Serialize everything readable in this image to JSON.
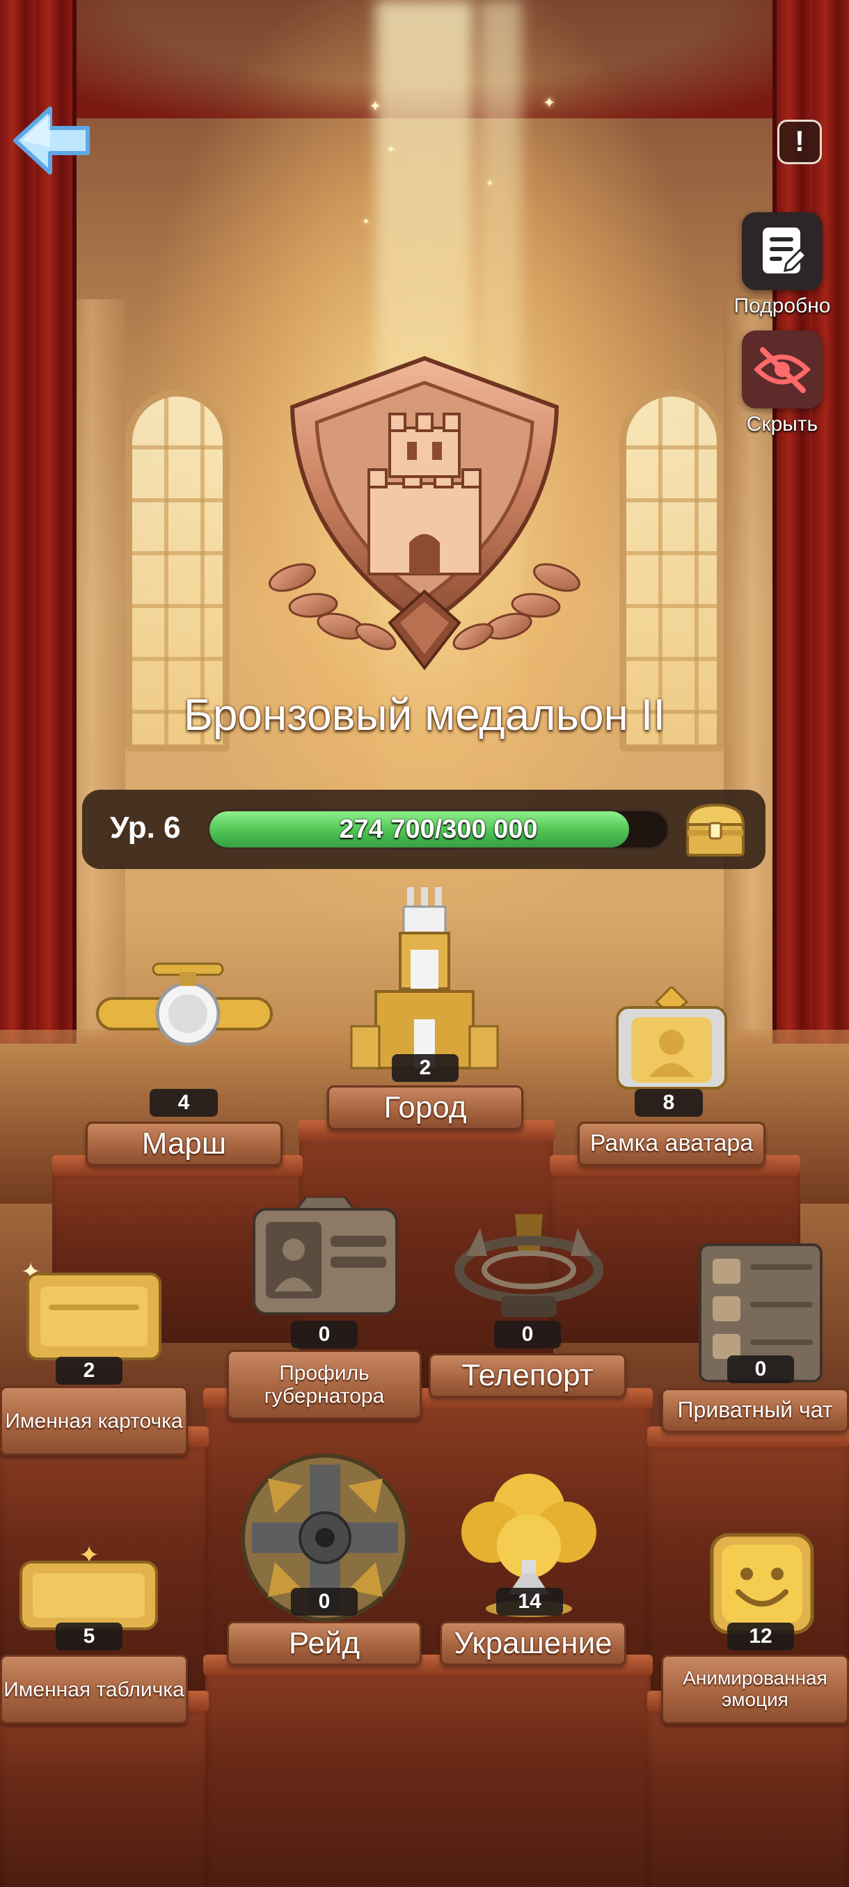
{
  "header": {
    "back_icon": "back-arrow-icon",
    "alert_icon": "exclamation-icon",
    "alert_symbol": "!",
    "details_label": "Подробно",
    "details_icon": "document-icon",
    "hide_label": "Скрыть",
    "hide_icon": "eye-off-icon"
  },
  "medal": {
    "icon": "bronze-castle-shield-medal",
    "title": "Бронзовый медальон II"
  },
  "level": {
    "label": "Ур. 6",
    "progress_text": "274 700/300 000",
    "progress_fraction": 0.9157,
    "reward_icon": "treasure-chest-icon"
  },
  "rewards": [
    {
      "id": "march",
      "label": "Марш",
      "count": "4",
      "icon": "airplane-icon"
    },
    {
      "id": "city",
      "label": "Город",
      "count": "2",
      "icon": "castle-icon"
    },
    {
      "id": "avatar-frame",
      "label": "Рамка аватара",
      "count": "8",
      "icon": "avatar-frame-icon"
    },
    {
      "id": "name-card",
      "label": "Именная карточка",
      "count": "2",
      "icon": "name-card-icon"
    },
    {
      "id": "governor-profile",
      "label": "Профиль губернатора",
      "count": "0",
      "icon": "profile-card-icon"
    },
    {
      "id": "teleport",
      "label": "Телепорт",
      "count": "0",
      "icon": "teleport-ring-icon"
    },
    {
      "id": "private-chat",
      "label": "Приватный чат",
      "count": "0",
      "icon": "chat-list-icon"
    },
    {
      "id": "nameplate",
      "label": "Именная табличка",
      "count": "5",
      "icon": "nameplate-icon"
    },
    {
      "id": "raid",
      "label": "Рейд",
      "count": "0",
      "icon": "raid-shield-icon"
    },
    {
      "id": "decoration",
      "label": "Украшение",
      "count": "14",
      "icon": "golden-tree-icon"
    },
    {
      "id": "emote",
      "label": "Анимированная эмоция",
      "count": "12",
      "icon": "smiley-icon"
    }
  ],
  "colors": {
    "progress_green": "#4ec353",
    "podium_red": "#6a2a17",
    "plate_brown": "#a5623e",
    "gold": "#e0b040"
  }
}
